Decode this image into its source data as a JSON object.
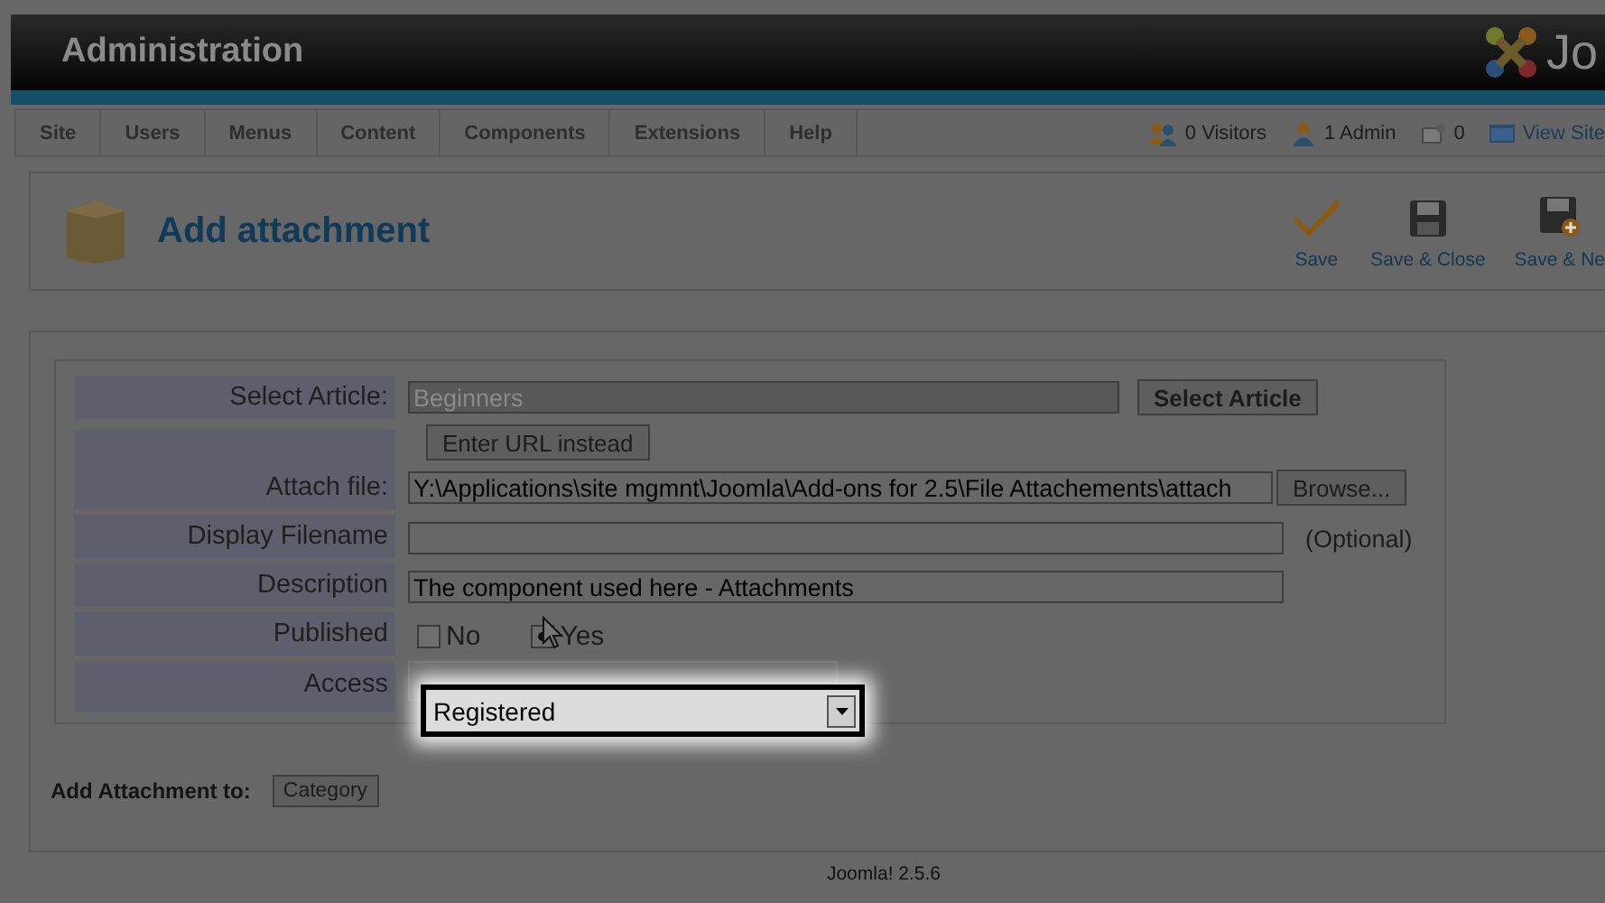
{
  "header": {
    "title": "Administration",
    "logo_text": "Jo"
  },
  "menu": [
    "Site",
    "Users",
    "Menus",
    "Content",
    "Components",
    "Extensions",
    "Help"
  ],
  "status": [
    {
      "kind": "visitors",
      "label": "0 Visitors"
    },
    {
      "kind": "admin",
      "label": "1 Admin"
    },
    {
      "kind": "messages",
      "label": "0"
    },
    {
      "kind": "view-site",
      "label": "View Site"
    }
  ],
  "page_title": "Add attachment",
  "toolbar": [
    {
      "kind": "save",
      "label": "Save"
    },
    {
      "kind": "save-close",
      "label": "Save & Close"
    },
    {
      "kind": "save-new",
      "label": "Save & Ne"
    }
  ],
  "form": {
    "select_article": {
      "label": "Select Article:",
      "value": "Beginners",
      "button": "Select Article"
    },
    "url_button": "Enter URL instead",
    "attach_file": {
      "label": "Attach file:",
      "value": "Y:\\Applications\\site mgmnt\\Joomla\\Add-ons for 2.5\\File Attachements\\attach",
      "button": "Browse..."
    },
    "display_filename": {
      "label": "Display Filename",
      "note": "(Optional)"
    },
    "description": {
      "label": "Description",
      "value": "The component used here - Attachments"
    },
    "published": {
      "label": "Published",
      "options": [
        {
          "label": "No",
          "selected": false
        },
        {
          "label": "Yes",
          "selected": true
        }
      ]
    },
    "access": {
      "label": "Access",
      "value": "Registered"
    }
  },
  "add_to": {
    "label": "Add Attachment to:",
    "button": "Category"
  },
  "footer": "Joomla! 2.5.6"
}
